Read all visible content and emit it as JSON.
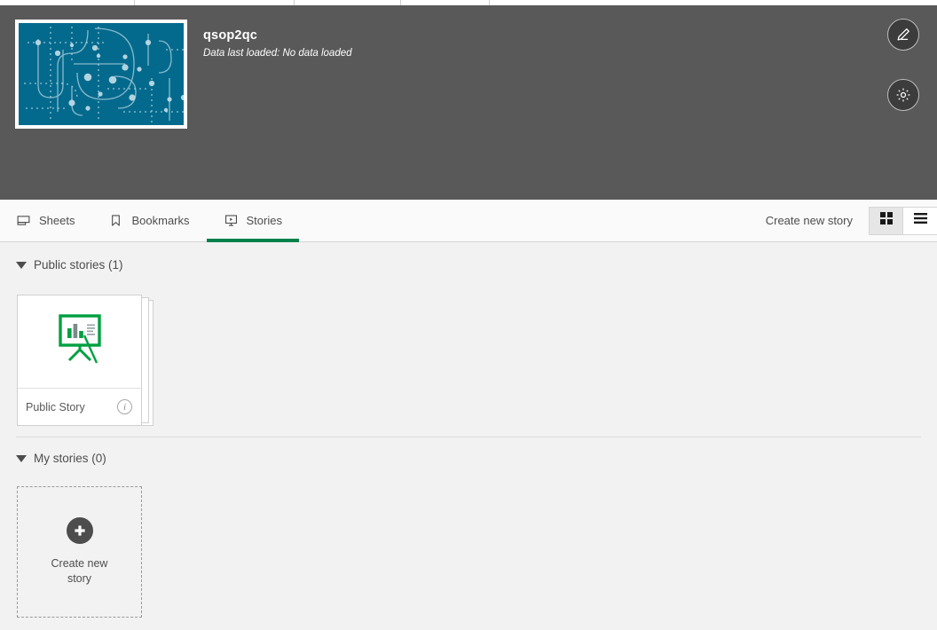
{
  "app": {
    "title": "qsop2qc",
    "data_status": "Data last loaded: No data loaded",
    "thumbnail_bg": "#046a8d",
    "header_bg": "#595959"
  },
  "header_actions": {
    "edit_label": "pencil-icon",
    "settings_label": "gear-icon"
  },
  "toolbar": {
    "tabs": [
      {
        "label": "Sheets",
        "icon": "sheet-icon",
        "active": false
      },
      {
        "label": "Bookmarks",
        "icon": "bookmark-icon",
        "active": false
      },
      {
        "label": "Stories",
        "icon": "story-icon",
        "active": true
      }
    ],
    "create_story_label": "Create new story",
    "views": [
      {
        "name": "grid-view",
        "icon": "grid-icon",
        "active": true
      },
      {
        "name": "list-view",
        "icon": "list-icon",
        "active": false
      }
    ],
    "active_tab_color": "#00814b"
  },
  "sections": {
    "public": {
      "title": "Public stories (1)",
      "expanded": true,
      "stories": [
        {
          "name": "Public Story",
          "info_icon": "info-icon"
        }
      ]
    },
    "my": {
      "title": "My stories (0)",
      "expanded": true,
      "stories": [],
      "create_card_label": "Create new story",
      "create_card_icon": "plus-circle-icon"
    }
  }
}
